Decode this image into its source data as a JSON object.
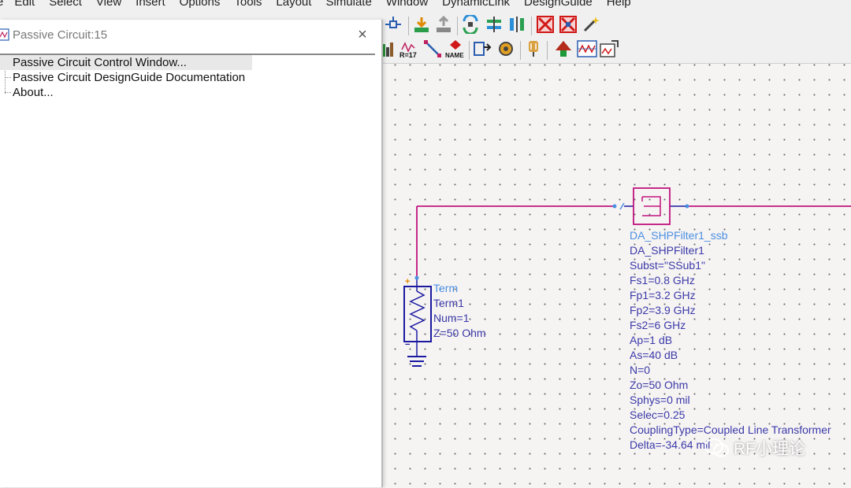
{
  "menu": [
    "e",
    "Edit",
    "Select",
    "View",
    "Insert",
    "Options",
    "Tools",
    "Layout",
    "Simulate",
    "Window",
    "DynamicLink",
    "DesignGuide",
    "Help"
  ],
  "dialog": {
    "title": "Passive Circuit:15",
    "close": "×",
    "items": [
      {
        "label": "Passive Circuit Control Window..."
      },
      {
        "label": "Passive Circuit DesignGuide Documentation"
      },
      {
        "label": "About..."
      }
    ]
  },
  "toolbar2": {
    "r17_label": "R=17",
    "name_label": "NAME"
  },
  "term": {
    "lines": [
      "Term",
      "Term1",
      "Num=1",
      "Z=50 Ohm"
    ],
    "plus": "+",
    "minus": "−"
  },
  "filter": {
    "lines": [
      "DA_SHPFilter1_ssb",
      "DA_SHPFilter1",
      "Subst=\"SSub1\"",
      "Fs1=0.8 GHz",
      "Fp1=3.2 GHz",
      "Fp2=3.9 GHz",
      "Fs2=6 GHz",
      "Ap=1 dB",
      "As=40 dB",
      "N=0",
      "Zo=50 Ohm",
      "Sphys=0 mil",
      "Selec=0.25",
      "CouplingType=Coupled Line Transformer",
      "Delta=-34.64 mil"
    ]
  },
  "watermark": "RF小理论",
  "colors": {
    "wire": "#c0147d",
    "component": "#1a1aa0",
    "pin": "#4a90e2",
    "filter_box": "#c0147d"
  }
}
